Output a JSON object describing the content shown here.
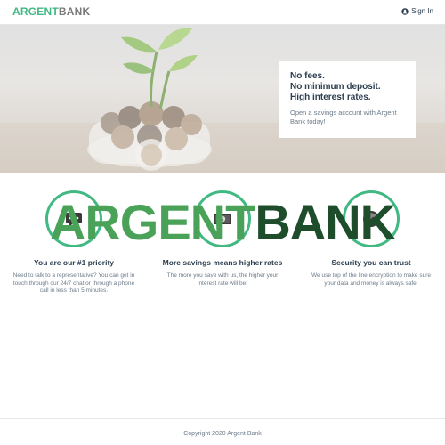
{
  "nav": {
    "logo_argent": "ARGENT",
    "logo_bank": "BANK",
    "signin_label": "Sign In"
  },
  "hero": {
    "line1": "No fees.",
    "line2": "No minimum deposit.",
    "line3": "High interest rates.",
    "sub": "Open a savings account with Argent Bank today!"
  },
  "features": [
    {
      "icon": "chat-icon",
      "title": "You are our #1 priority",
      "text": "Need to talk to a representative? You can get in touch through our 24/7 chat or through a phone call in less than 5 minutes."
    },
    {
      "icon": "money-icon",
      "title": "More savings means higher rates",
      "text": "The more you save with us, the higher your interest rate will be!"
    },
    {
      "icon": "security-icon",
      "title": "Security you can trust",
      "text": "We use top of the line encryption to make sure your data and money is always safe."
    }
  ],
  "wordmark": {
    "argent": "ARGENT",
    "bank": "BANK"
  },
  "footer": {
    "text": "Copyright 2020 Argent Bank"
  },
  "colors": {
    "accent": "#42b983",
    "text": "#2c3e50",
    "wordmark_green": "#4aa259",
    "wordmark_dark": "#1e4d2b"
  }
}
